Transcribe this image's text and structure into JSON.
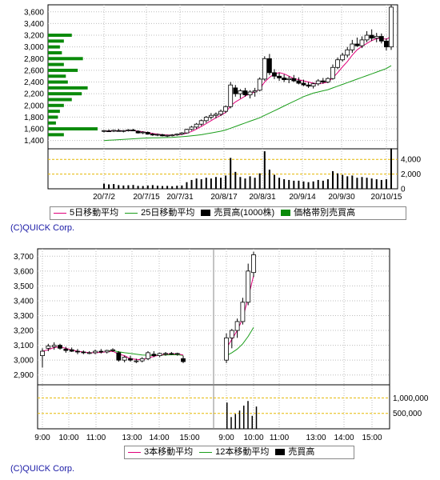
{
  "chart_data": [
    {
      "type": "candlestick",
      "title": "",
      "x_tick_labels": [
        "20/7/2",
        "20/7/15",
        "20/7/31",
        "20/8/17",
        "20/8/31",
        "20/9/14",
        "20/9/30",
        "20/10/15"
      ],
      "price_axis": {
        "ticks": [
          1400,
          1600,
          1800,
          2000,
          2200,
          2400,
          2600,
          2800,
          3000,
          3200,
          3400,
          3600
        ],
        "tick_labels": [
          "1,400",
          "1,600",
          "1,800",
          "2,000",
          "2,200",
          "2,400",
          "2,600",
          "2,800",
          "3,000",
          "3,200",
          "3,400",
          "3,600"
        ],
        "range": [
          1300,
          3720
        ]
      },
      "volume_axis": {
        "ticks": [
          0,
          2000,
          4000
        ],
        "tick_labels": [
          "0",
          "2,000",
          "4,000"
        ],
        "range": [
          0,
          5000
        ],
        "unit": "1000株"
      },
      "legend": [
        {
          "name": "5日移動平均",
          "color": "#e0007a"
        },
        {
          "name": "25日移動平均",
          "color": "#1b9e1b"
        },
        {
          "name": "売買高(1000株)",
          "color": "#000000"
        },
        {
          "name": "価格帯別売買高",
          "color": "#0a8a0a"
        }
      ],
      "ohlc": [
        [
          1560,
          1580,
          1540,
          1570
        ],
        [
          1565,
          1590,
          1550,
          1560
        ],
        [
          1560,
          1585,
          1545,
          1575
        ],
        [
          1570,
          1600,
          1555,
          1565
        ],
        [
          1560,
          1580,
          1540,
          1570
        ],
        [
          1575,
          1595,
          1555,
          1580
        ],
        [
          1580,
          1600,
          1560,
          1565
        ],
        [
          1560,
          1575,
          1520,
          1530
        ],
        [
          1535,
          1560,
          1510,
          1545
        ],
        [
          1540,
          1555,
          1500,
          1510
        ],
        [
          1510,
          1530,
          1480,
          1495
        ],
        [
          1495,
          1520,
          1475,
          1505
        ],
        [
          1500,
          1515,
          1470,
          1480
        ],
        [
          1480,
          1500,
          1460,
          1490
        ],
        [
          1490,
          1510,
          1470,
          1495
        ],
        [
          1495,
          1520,
          1480,
          1510
        ],
        [
          1510,
          1545,
          1495,
          1530
        ],
        [
          1530,
          1600,
          1520,
          1590
        ],
        [
          1590,
          1650,
          1570,
          1630
        ],
        [
          1630,
          1700,
          1600,
          1680
        ],
        [
          1680,
          1760,
          1650,
          1740
        ],
        [
          1740,
          1820,
          1700,
          1800
        ],
        [
          1800,
          1870,
          1760,
          1830
        ],
        [
          1830,
          1880,
          1780,
          1850
        ],
        [
          1850,
          1930,
          1820,
          1900
        ],
        [
          1900,
          2000,
          1870,
          1980
        ],
        [
          1980,
          2400,
          1950,
          2350
        ],
        [
          2300,
          2350,
          2150,
          2200
        ],
        [
          2200,
          2280,
          2120,
          2250
        ],
        [
          2250,
          2300,
          2150,
          2180
        ],
        [
          2180,
          2260,
          2120,
          2230
        ],
        [
          2230,
          2300,
          2150,
          2250
        ],
        [
          2260,
          2480,
          2240,
          2450
        ],
        [
          2450,
          2840,
          2420,
          2800
        ],
        [
          2800,
          2880,
          2520,
          2560
        ],
        [
          2560,
          2620,
          2450,
          2500
        ],
        [
          2500,
          2560,
          2420,
          2470
        ],
        [
          2470,
          2530,
          2400,
          2440
        ],
        [
          2440,
          2500,
          2380,
          2460
        ],
        [
          2460,
          2520,
          2400,
          2420
        ],
        [
          2420,
          2480,
          2360,
          2380
        ],
        [
          2380,
          2440,
          2330,
          2350
        ],
        [
          2350,
          2400,
          2300,
          2330
        ],
        [
          2330,
          2390,
          2290,
          2370
        ],
        [
          2370,
          2450,
          2340,
          2420
        ],
        [
          2420,
          2470,
          2370,
          2400
        ],
        [
          2400,
          2480,
          2380,
          2460
        ],
        [
          2460,
          2700,
          2440,
          2650
        ],
        [
          2650,
          2820,
          2620,
          2780
        ],
        [
          2780,
          2900,
          2750,
          2860
        ],
        [
          2860,
          3000,
          2820,
          2950
        ],
        [
          2950,
          3120,
          2900,
          3050
        ],
        [
          3050,
          3160,
          3000,
          3020
        ],
        [
          3020,
          3180,
          2980,
          3120
        ],
        [
          3120,
          3270,
          3080,
          3200
        ],
        [
          3200,
          3300,
          3100,
          3150
        ],
        [
          3150,
          3240,
          3080,
          3180
        ],
        [
          3180,
          3230,
          3060,
          3100
        ],
        [
          3100,
          3150,
          2940,
          3000
        ],
        [
          3000,
          3720,
          2950,
          3680
        ]
      ],
      "ma5": [
        1560,
        1562,
        1565,
        1568,
        1567,
        1570,
        1572,
        1560,
        1550,
        1538,
        1520,
        1510,
        1500,
        1495,
        1493,
        1497,
        1505,
        1525,
        1555,
        1595,
        1640,
        1690,
        1740,
        1790,
        1830,
        1880,
        1990,
        2060,
        2110,
        2160,
        2200,
        2230,
        2280,
        2400,
        2480,
        2540,
        2560,
        2540,
        2500,
        2460,
        2440,
        2420,
        2400,
        2380,
        2370,
        2380,
        2400,
        2470,
        2560,
        2660,
        2750,
        2860,
        2950,
        3010,
        3060,
        3110,
        3140,
        3150,
        3130,
        3180
      ],
      "ma25": [
        1400,
        1405,
        1410,
        1415,
        1420,
        1425,
        1430,
        1435,
        1440,
        1443,
        1446,
        1448,
        1450,
        1452,
        1455,
        1460,
        1465,
        1472,
        1480,
        1490,
        1500,
        1515,
        1530,
        1545,
        1560,
        1580,
        1610,
        1640,
        1670,
        1700,
        1730,
        1760,
        1790,
        1830,
        1870,
        1910,
        1950,
        1990,
        2030,
        2070,
        2110,
        2150,
        2180,
        2210,
        2230,
        2250,
        2270,
        2300,
        2330,
        2360,
        2390,
        2420,
        2450,
        2480,
        2510,
        2540,
        2570,
        2600,
        2630,
        2680
      ],
      "volume": [
        700,
        600,
        650,
        500,
        450,
        480,
        520,
        400,
        380,
        450,
        500,
        420,
        380,
        400,
        350,
        420,
        450,
        900,
        1200,
        1400,
        1300,
        1500,
        1400,
        1600,
        1500,
        1800,
        4200,
        2300,
        1600,
        1400,
        1700,
        1500,
        2100,
        5100,
        2600,
        1900,
        1500,
        1300,
        1200,
        1100,
        1100,
        1000,
        900,
        1000,
        1200,
        1100,
        1300,
        2400,
        2100,
        1900,
        1700,
        1800,
        1500,
        1600,
        1500,
        1400,
        1300,
        1200,
        1300,
        5500
      ],
      "volume_by_price": [
        {
          "price": 3200,
          "volume": 60
        },
        {
          "price": 3100,
          "volume": 40
        },
        {
          "price": 3000,
          "volume": 30
        },
        {
          "price": 2900,
          "volume": 35
        },
        {
          "price": 2800,
          "volume": 88
        },
        {
          "price": 2700,
          "volume": 40
        },
        {
          "price": 2600,
          "volume": 75
        },
        {
          "price": 2500,
          "volume": 45
        },
        {
          "price": 2400,
          "volume": 50
        },
        {
          "price": 2300,
          "volume": 100
        },
        {
          "price": 2200,
          "volume": 85
        },
        {
          "price": 2100,
          "volume": 60
        },
        {
          "price": 2000,
          "volume": 40
        },
        {
          "price": 1900,
          "volume": 30
        },
        {
          "price": 1800,
          "volume": 25
        },
        {
          "price": 1700,
          "volume": 20
        },
        {
          "price": 1600,
          "volume": 125
        },
        {
          "price": 1500,
          "volume": 40
        }
      ]
    },
    {
      "type": "candlestick",
      "title": "",
      "x_tick_labels": [
        "9:00",
        "10:00",
        "11:00",
        "13:00",
        "14:00",
        "15:00",
        "9:00",
        "10:00",
        "11:00",
        "13:00",
        "14:00",
        "15:00"
      ],
      "price_axis": {
        "ticks": [
          2900,
          3000,
          3100,
          3200,
          3300,
          3400,
          3500,
          3600,
          3700
        ],
        "tick_labels": [
          "2,900",
          "3,000",
          "3,100",
          "3,200",
          "3,300",
          "3,400",
          "3,500",
          "3,600",
          "3,700"
        ],
        "range": [
          2850,
          3750
        ]
      },
      "volume_axis": {
        "ticks": [
          500000,
          1000000
        ],
        "tick_labels": [
          "500,000",
          "1,000,000"
        ],
        "range": [
          0,
          1450000
        ]
      },
      "legend": [
        {
          "name": "3本移動平均",
          "color": "#e0007a"
        },
        {
          "name": "12本移動平均",
          "color": "#1b9e1b"
        },
        {
          "name": "売買高",
          "color": "#000000"
        }
      ],
      "day1": {
        "ohlc": [
          [
            3030,
            3080,
            2950,
            3060
          ],
          [
            3080,
            3110,
            3060,
            3095
          ],
          [
            3090,
            3120,
            3070,
            3100
          ],
          [
            3100,
            3110,
            3070,
            3080
          ],
          [
            3075,
            3090,
            3050,
            3065
          ],
          [
            3070,
            3085,
            3055,
            3060
          ],
          [
            3060,
            3075,
            3040,
            3055
          ],
          [
            3055,
            3065,
            3040,
            3050
          ],
          [
            3045,
            3060,
            3040,
            3050
          ],
          [
            3050,
            3070,
            3040,
            3060
          ],
          [
            3060,
            3075,
            3045,
            3055
          ],
          [
            3055,
            3070,
            3045,
            3065
          ],
          [
            3065,
            3080,
            3055,
            3070
          ],
          [
            3050,
            3060,
            2990,
            3000
          ],
          [
            3000,
            3030,
            2985,
            3020
          ],
          [
            3010,
            3030,
            2990,
            3000
          ],
          [
            2990,
            3010,
            2980,
            2995
          ],
          [
            2995,
            3020,
            2985,
            3010
          ],
          [
            3010,
            3060,
            3000,
            3050
          ],
          [
            3040,
            3060,
            3020,
            3030
          ],
          [
            3030,
            3050,
            3020,
            3045
          ],
          [
            3040,
            3055,
            3030,
            3045
          ],
          [
            3045,
            3055,
            3035,
            3040
          ],
          [
            3040,
            3050,
            3030,
            3045
          ],
          [
            3010,
            3030,
            2980,
            2990
          ]
        ],
        "ma3": [
          3060,
          3070,
          3085,
          3090,
          3080,
          3068,
          3060,
          3055,
          3050,
          3050,
          3052,
          3056,
          3060,
          3040,
          3030,
          3010,
          3005,
          3002,
          3015,
          3025,
          3035,
          3040,
          3042,
          3043,
          3035
        ],
        "ma12": [
          null,
          null,
          null,
          null,
          null,
          null,
          null,
          null,
          null,
          null,
          null,
          3063,
          3064,
          3056,
          3050,
          3045,
          3040,
          3035,
          3033,
          3033,
          3034,
          3035,
          3036,
          3036,
          3032
        ],
        "volume": []
      },
      "day2": {
        "ohlc": [
          [
            3000,
            3180,
            2980,
            3150
          ],
          [
            3150,
            3210,
            3080,
            3200
          ],
          [
            3200,
            3280,
            3150,
            3260
          ],
          [
            3260,
            3420,
            3240,
            3390
          ],
          [
            3390,
            3650,
            3370,
            3600
          ],
          [
            3590,
            3730,
            3560,
            3710
          ]
        ],
        "ma3": [
          3080,
          3140,
          3200,
          3280,
          3420,
          3570
        ],
        "ma12": [
          3030,
          3050,
          3075,
          3110,
          3160,
          3220
        ],
        "volume": [
          850000,
          380000,
          480000,
          590000,
          750000,
          900000,
          420000,
          720000
        ]
      }
    }
  ],
  "copyright": {
    "top": "(C)QUICK Corp.",
    "bottom": "(C)QUICK Corp."
  }
}
